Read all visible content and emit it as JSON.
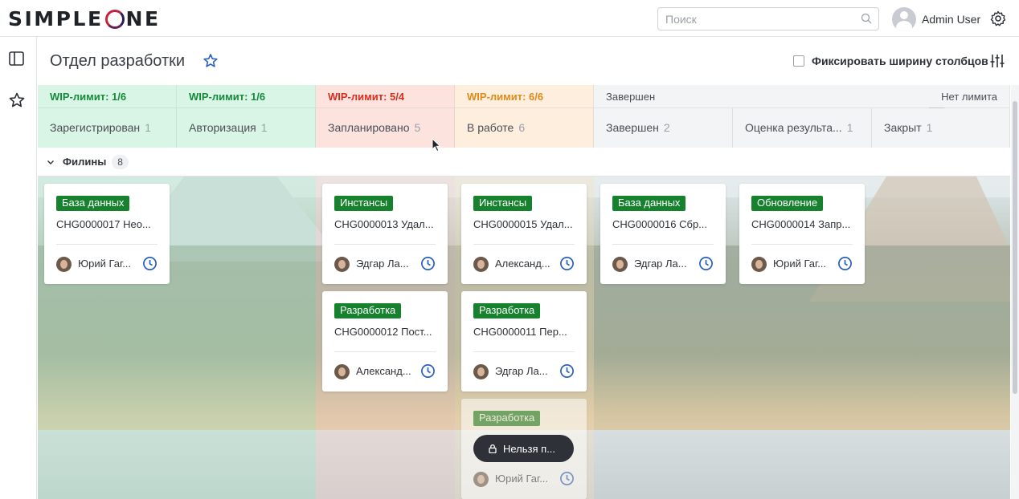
{
  "header": {
    "logo_left": "SIMPLE",
    "logo_right": "NE",
    "search_placeholder": "Поиск",
    "user_name": "Admin User"
  },
  "page": {
    "title": "Отдел разработки",
    "fix_width_label": "Фиксировать ширину столбцов"
  },
  "wip": [
    {
      "label": "WIP-лимит: 1/6",
      "tone": "green"
    },
    {
      "label": "WIP-лимит: 1/6",
      "tone": "green"
    },
    {
      "label": "WIP-лимит: 5/4",
      "tone": "red"
    },
    {
      "label": "WIP-лимит: 6/6",
      "tone": "orange"
    },
    {
      "label": "Завершен",
      "tone": "grey",
      "right": "Нет лимита"
    }
  ],
  "columns": [
    {
      "name": "Зарегистрирован",
      "count": "1"
    },
    {
      "name": "Авторизация",
      "count": "1"
    },
    {
      "name": "Запланировано",
      "count": "5"
    },
    {
      "name": "В работе",
      "count": "6"
    },
    {
      "name": "Завершен",
      "count": "2"
    },
    {
      "name": "Оценка результа...",
      "count": "1"
    },
    {
      "name": "Закрыт",
      "count": "1"
    }
  ],
  "group": {
    "name": "Филины",
    "count": "8"
  },
  "cards": [
    {
      "tag": "База данных",
      "number": "CHG0000017 Нео...",
      "person": "Юрий Гаг..."
    },
    {
      "tag": "Инстансы",
      "number": "CHG0000013 Удал...",
      "person": "Эдгар Ла..."
    },
    {
      "tag": "Инстансы",
      "number": "CHG0000015 Удал...",
      "person": "Александ..."
    },
    {
      "tag": "База данных",
      "number": "CHG0000016 Сбр...",
      "person": "Эдгар Ла..."
    },
    {
      "tag": "Обновление",
      "number": "CHG0000014 Запр...",
      "person": "Юрий Гаг..."
    },
    {
      "tag": "Разработка",
      "number": "CHG0000012 Пост...",
      "person": "Александ..."
    },
    {
      "tag": "Разработка",
      "number": "CHG0000011 Пер...",
      "person": "Эдгар Ла..."
    },
    {
      "tag": "Разработка",
      "number": "",
      "person": "Юрий Гаг..."
    }
  ],
  "tooltip": "Нельзя п...",
  "colors": {
    "tag_green": "#17822e",
    "wip_green": "#168a3b",
    "wip_red": "#d92e1d",
    "wip_orange": "#e08a1a"
  }
}
